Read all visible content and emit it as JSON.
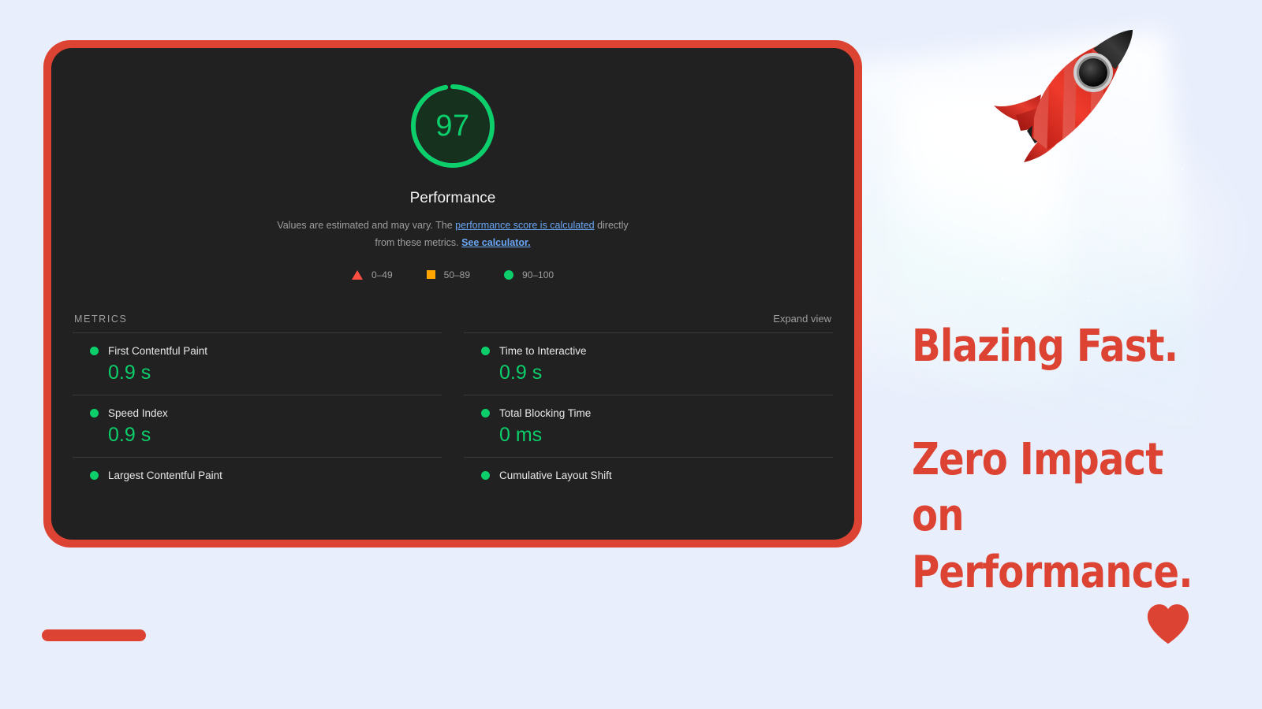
{
  "page": {
    "background_color": "#e8eefc",
    "accent_red": "#dd4333",
    "score_green": "#0cce6b"
  },
  "report": {
    "card_border_color": "#dd4333",
    "card_background": "#212121",
    "gauge": {
      "score": "97",
      "category_label": "Performance",
      "score_percent": 97,
      "color": "#0cce6b"
    },
    "description": {
      "prefix": "Values are estimated and may vary. The ",
      "link1": "performance score is calculated",
      "middle": " directly from these metrics. ",
      "link2": "See calculator."
    },
    "legend": [
      {
        "icon": "triangle-icon",
        "range": "0–49",
        "color": "#ff4e42"
      },
      {
        "icon": "square-icon",
        "range": "50–89",
        "color": "#ffa400"
      },
      {
        "icon": "circle-icon",
        "range": "90–100",
        "color": "#0cce6b"
      }
    ],
    "metrics_section": {
      "title": "METRICS",
      "expand_label": "Expand view"
    },
    "metrics": [
      {
        "name": "First Contentful Paint",
        "value": "0.9 s",
        "status": "pass"
      },
      {
        "name": "Time to Interactive",
        "value": "0.9 s",
        "status": "pass"
      },
      {
        "name": "Speed Index",
        "value": "0.9 s",
        "status": "pass"
      },
      {
        "name": "Total Blocking Time",
        "value": "0 ms",
        "status": "pass"
      },
      {
        "name": "Largest Contentful Paint",
        "value": "",
        "status": "pass"
      },
      {
        "name": "Cumulative Layout Shift",
        "value": "",
        "status": "pass"
      }
    ]
  },
  "marketing": {
    "headline_line1": "Blazing Fast.",
    "headline_line2": "Zero Impact on",
    "headline_line3": "Performance.",
    "color": "#dd4333"
  },
  "decor": {
    "rocket_icon": "rocket-icon",
    "heart_icon": "heart-icon"
  }
}
